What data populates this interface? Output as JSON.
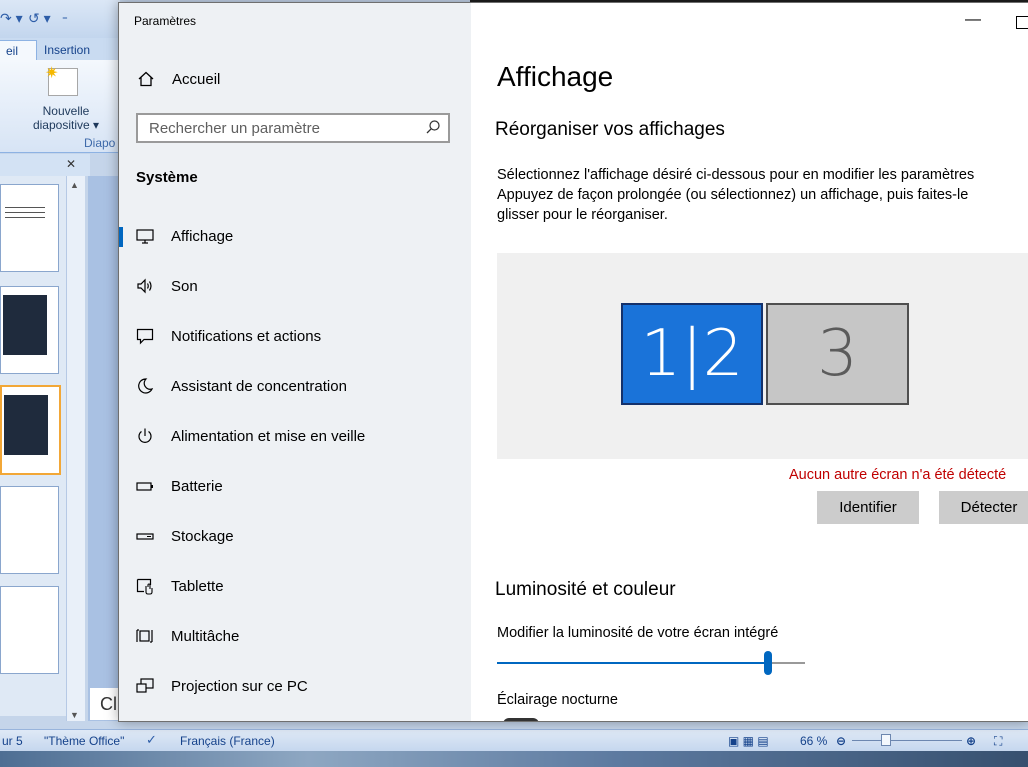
{
  "powerpoint": {
    "tabs": [
      "eil",
      "Insertion"
    ],
    "new_slide_label": "Nouvelle diapositive ▾",
    "group_label": "Diapo",
    "notes_text": "Cl",
    "status": {
      "slide": "ur 5",
      "theme": "\"Thème Office\"",
      "language": "Français (France)",
      "zoom": "66 %",
      "zoom_fraction": 0.3
    }
  },
  "settings": {
    "app_title": "Paramètres",
    "home_label": "Accueil",
    "search_placeholder": "Rechercher un paramètre",
    "section_label": "Système",
    "nav_items": [
      {
        "label": "Affichage",
        "icon": "monitor-icon"
      },
      {
        "label": "Son",
        "icon": "speaker-icon"
      },
      {
        "label": "Notifications et actions",
        "icon": "notification-icon"
      },
      {
        "label": "Assistant de concentration",
        "icon": "moon-icon"
      },
      {
        "label": "Alimentation et mise en veille",
        "icon": "power-icon"
      },
      {
        "label": "Batterie",
        "icon": "battery-icon"
      },
      {
        "label": "Stockage",
        "icon": "storage-icon"
      },
      {
        "label": "Tablette",
        "icon": "tablet-icon"
      },
      {
        "label": "Multitâche",
        "icon": "multitask-icon"
      },
      {
        "label": "Projection sur ce PC",
        "icon": "projection-icon"
      }
    ],
    "active_item": 0,
    "page_title": "Affichage",
    "arrange_title": "Réorganiser vos affichages",
    "arrange_desc": [
      "Sélectionnez l'affichage désiré ci-dessous pour en modifier les paramètres",
      "Appuyez de façon prolongée (ou sélectionnez) un affichage, puis faites-le",
      "glisser pour le réorganiser."
    ],
    "monitors": [
      "1|2",
      "3"
    ],
    "no_screen_msg": "Aucun autre écran n'a été détecté",
    "identify_label": "Identifier",
    "detect_label": "Détecter",
    "brightness_title": "Luminosité et couleur",
    "brightness_label": "Modifier la luminosité de votre écran intégré",
    "brightness_value": 0.88,
    "night_light_label": "Éclairage nocturne",
    "colors": {
      "accent": "#0067c0",
      "monitor_active": "#1a73d9",
      "warning": "#c00000"
    }
  }
}
